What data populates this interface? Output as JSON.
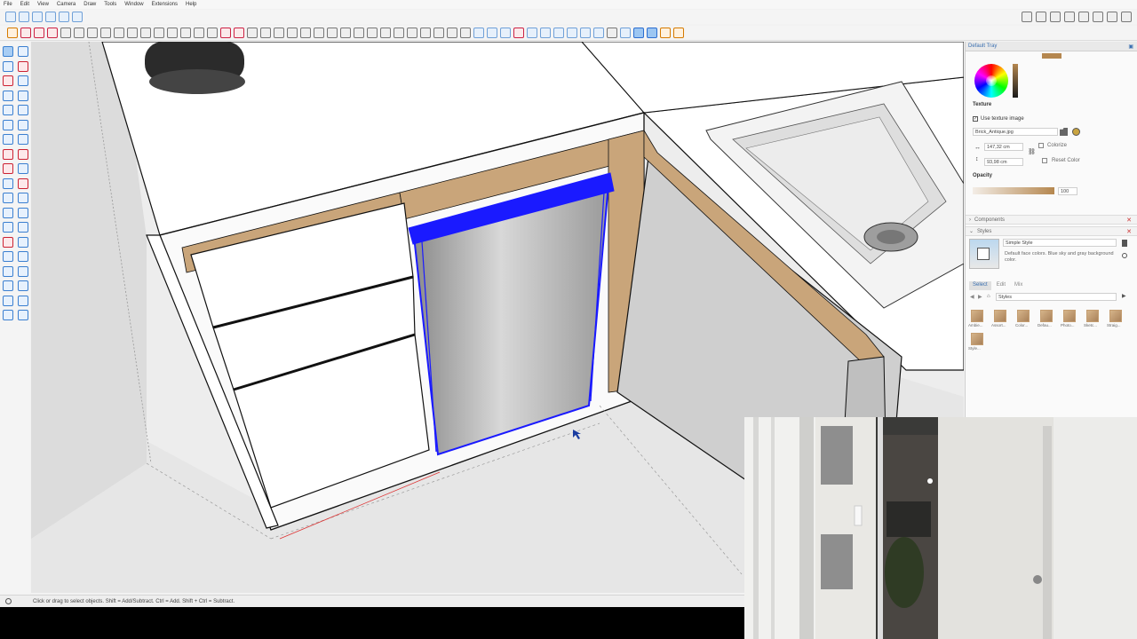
{
  "menu": [
    "File",
    "Edit",
    "View",
    "Camera",
    "Draw",
    "Tools",
    "Window",
    "Extensions",
    "Help"
  ],
  "status_text": "Click or drag to select objects. Shift = Add/Subtract. Ctrl = Add. Shift + Ctrl = Subtract.",
  "tray": {
    "title": "Default Tray",
    "texture_label": "Texture",
    "use_texture_label": "Use texture image",
    "texture_file": "Brick_Antique.jpg",
    "width_value": "147,32 cm",
    "height_value": "93,98 cm",
    "colorize_label": "Colorize",
    "reset_color_label": "Reset Color",
    "opacity_label": "Opacity",
    "opacity_value": "100",
    "components_label": "Components",
    "styles_label": "Styles",
    "style_name": "Simple Style",
    "style_desc": "Default face colors. Blue sky and gray background color.",
    "tabs": [
      "Select",
      "Edit",
      "Mix"
    ],
    "collection": "Styles",
    "style_items": [
      "Ambie...",
      "Assort...",
      "Color...",
      "Defau...",
      "Photo...",
      "Sketc...",
      "Straig...",
      "Style..."
    ]
  },
  "colors": {
    "selection": "#1a1aff",
    "accent": "#3b7fd0",
    "wood": "#c9a57a"
  }
}
